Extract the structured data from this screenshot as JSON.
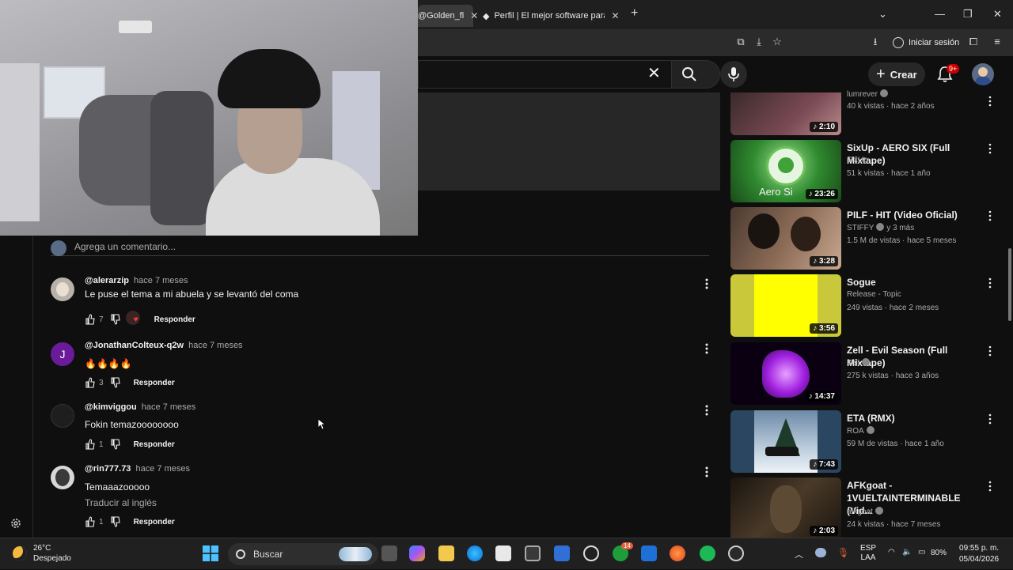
{
  "browser": {
    "tabs": [
      {
        "label": "@Golden_fl",
        "active": true
      },
      {
        "label": "Perfil | El mejor software para p"
      }
    ],
    "login_label": "Iniciar sesión"
  },
  "header": {
    "create_label": "Crear",
    "notifications_badge": "9+"
  },
  "comments": {
    "placeholder": "Agrega un comentario...",
    "reply_label": "Responder",
    "items": [
      {
        "user": "@alerarzip",
        "time": "hace 7 meses",
        "text": "Le puse el tema a mi abuela y se levantó del coma",
        "likes": "7",
        "creator_heart": true
      },
      {
        "user": "@JonathanColteux-q2w",
        "time": "hace 7 meses",
        "text": "🔥🔥🔥🔥",
        "likes": "3",
        "avatar_letter": "J"
      },
      {
        "user": "@kimviggou",
        "time": "hace 7 meses",
        "text": "Fokin temazoooooooo",
        "likes": "1"
      },
      {
        "user": "@rin777.73",
        "time": "hace 7 meses",
        "text": "Temaaazooooo",
        "likes": "1",
        "translate": "Traducir al inglés"
      }
    ]
  },
  "related": [
    {
      "title": "",
      "channel": "lumrever",
      "meta": "40 k vistas · hace 2 años",
      "duration": "2:10",
      "verified": true
    },
    {
      "title": "SixUp - AERO SIX (Full Mixtape)",
      "channel": "SixUp",
      "meta": "51 k vistas · hace 1 año",
      "duration": "23:26"
    },
    {
      "title": "PILF - HIT (Video Oficial)",
      "channel": "STIFFY",
      "channel_extra": "y 3 más",
      "meta": "1.5 M de vistas · hace 5 meses",
      "duration": "3:28",
      "verified": true
    },
    {
      "title": "Sogue",
      "channel": "Release - Topic",
      "meta": "249 vistas · hace 2 meses",
      "duration": "3:56"
    },
    {
      "title": "Zell - Evil Season (Full Mixtape)",
      "channel": "Zell",
      "meta": "275 k vistas · hace 3 años",
      "duration": "14:37",
      "verified": true
    },
    {
      "title": "ETA (RMX)",
      "channel": "ROA",
      "meta": "59 M de vistas · hace 1 año",
      "duration": "7:43",
      "verified": true
    },
    {
      "title": "AFKgoat - 1VUELTAINTERMINABLE (Vid...",
      "channel": "afkgoat",
      "meta": "24 k vistas · hace 7 meses",
      "duration": "2:03",
      "verified": true
    }
  ],
  "thumb_text": {
    "aero": "Aero Si"
  },
  "taskbar": {
    "temperature": "26°C",
    "weather": "Despejado",
    "search_label": "Buscar",
    "xbox_badge": "14",
    "language": "ESP",
    "layout": "LAA",
    "battery": "80%",
    "time": "09:55 p. m.",
    "date": "05/04/2026"
  },
  "colors": {
    "background": "#0f0f0f",
    "accent_red": "#cc0000",
    "text_secondary": "#aaaaaa"
  }
}
